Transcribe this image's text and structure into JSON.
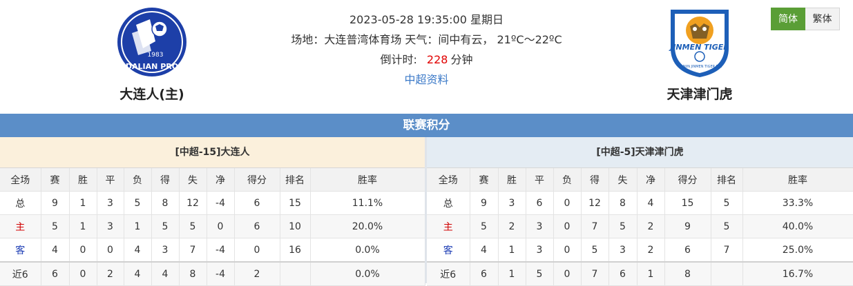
{
  "match": {
    "datetime": "2023-05-28 19:35:00 星期日",
    "venue_line": "场地：大连普湾体育场 天气：间中有云， 21ºC～22ºC",
    "countdown_label": "倒计时:",
    "countdown_value": "228",
    "countdown_unit": "分钟",
    "league_link": "中超资料"
  },
  "home_team": {
    "name": "大连人(主)",
    "logo_year": "1983",
    "logo_text": "DALIAN PRO"
  },
  "away_team": {
    "name": "天津津门虎",
    "logo_text": "JINMEN TIGER",
    "logo_subtext": "TIANJIN JINMEN TIGER F.C."
  },
  "lang": {
    "simplified": "简体",
    "traditional": "繁体"
  },
  "standings": {
    "title": "联赛积分",
    "headers": [
      "全场",
      "赛",
      "胜",
      "平",
      "负",
      "得",
      "失",
      "净",
      "得分",
      "排名",
      "胜率"
    ],
    "home": {
      "title": "[中超-15]大连人",
      "rows": [
        [
          "总",
          "9",
          "1",
          "3",
          "5",
          "8",
          "12",
          "-4",
          "6",
          "15",
          "11.1%"
        ],
        [
          "主",
          "5",
          "1",
          "3",
          "1",
          "5",
          "5",
          "0",
          "6",
          "10",
          "20.0%"
        ],
        [
          "客",
          "4",
          "0",
          "0",
          "4",
          "3",
          "7",
          "-4",
          "0",
          "16",
          "0.0%"
        ],
        [
          "近6",
          "6",
          "0",
          "2",
          "4",
          "4",
          "8",
          "-4",
          "2",
          "",
          "0.0%"
        ]
      ]
    },
    "away": {
      "title": "[中超-5]天津津门虎",
      "rows": [
        [
          "总",
          "9",
          "3",
          "6",
          "0",
          "12",
          "8",
          "4",
          "15",
          "5",
          "33.3%"
        ],
        [
          "主",
          "5",
          "2",
          "3",
          "0",
          "7",
          "5",
          "2",
          "9",
          "5",
          "40.0%"
        ],
        [
          "客",
          "4",
          "1",
          "3",
          "0",
          "5",
          "3",
          "2",
          "6",
          "7",
          "25.0%"
        ],
        [
          "近6",
          "6",
          "1",
          "5",
          "0",
          "7",
          "6",
          "1",
          "8",
          "",
          "16.7%"
        ]
      ]
    }
  },
  "colors": {
    "banner": "#5b8ec8",
    "home_panel": "#fbf0dc",
    "away_panel": "#e4ecf3",
    "lang_active": "#5a9e36",
    "countdown": "#e10000"
  }
}
